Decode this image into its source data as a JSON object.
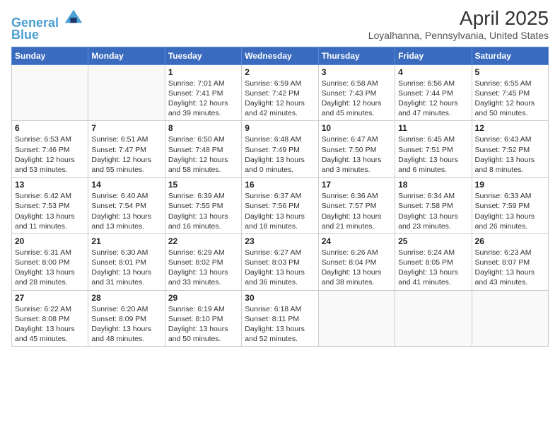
{
  "header": {
    "logo_line1": "General",
    "logo_line2": "Blue",
    "month_year": "April 2025",
    "location": "Loyalhanna, Pennsylvania, United States"
  },
  "days_of_week": [
    "Sunday",
    "Monday",
    "Tuesday",
    "Wednesday",
    "Thursday",
    "Friday",
    "Saturday"
  ],
  "weeks": [
    [
      {
        "day": "",
        "info": ""
      },
      {
        "day": "",
        "info": ""
      },
      {
        "day": "1",
        "info": "Sunrise: 7:01 AM\nSunset: 7:41 PM\nDaylight: 12 hours and 39 minutes."
      },
      {
        "day": "2",
        "info": "Sunrise: 6:59 AM\nSunset: 7:42 PM\nDaylight: 12 hours and 42 minutes."
      },
      {
        "day": "3",
        "info": "Sunrise: 6:58 AM\nSunset: 7:43 PM\nDaylight: 12 hours and 45 minutes."
      },
      {
        "day": "4",
        "info": "Sunrise: 6:56 AM\nSunset: 7:44 PM\nDaylight: 12 hours and 47 minutes."
      },
      {
        "day": "5",
        "info": "Sunrise: 6:55 AM\nSunset: 7:45 PM\nDaylight: 12 hours and 50 minutes."
      }
    ],
    [
      {
        "day": "6",
        "info": "Sunrise: 6:53 AM\nSunset: 7:46 PM\nDaylight: 12 hours and 53 minutes."
      },
      {
        "day": "7",
        "info": "Sunrise: 6:51 AM\nSunset: 7:47 PM\nDaylight: 12 hours and 55 minutes."
      },
      {
        "day": "8",
        "info": "Sunrise: 6:50 AM\nSunset: 7:48 PM\nDaylight: 12 hours and 58 minutes."
      },
      {
        "day": "9",
        "info": "Sunrise: 6:48 AM\nSunset: 7:49 PM\nDaylight: 13 hours and 0 minutes."
      },
      {
        "day": "10",
        "info": "Sunrise: 6:47 AM\nSunset: 7:50 PM\nDaylight: 13 hours and 3 minutes."
      },
      {
        "day": "11",
        "info": "Sunrise: 6:45 AM\nSunset: 7:51 PM\nDaylight: 13 hours and 6 minutes."
      },
      {
        "day": "12",
        "info": "Sunrise: 6:43 AM\nSunset: 7:52 PM\nDaylight: 13 hours and 8 minutes."
      }
    ],
    [
      {
        "day": "13",
        "info": "Sunrise: 6:42 AM\nSunset: 7:53 PM\nDaylight: 13 hours and 11 minutes."
      },
      {
        "day": "14",
        "info": "Sunrise: 6:40 AM\nSunset: 7:54 PM\nDaylight: 13 hours and 13 minutes."
      },
      {
        "day": "15",
        "info": "Sunrise: 6:39 AM\nSunset: 7:55 PM\nDaylight: 13 hours and 16 minutes."
      },
      {
        "day": "16",
        "info": "Sunrise: 6:37 AM\nSunset: 7:56 PM\nDaylight: 13 hours and 18 minutes."
      },
      {
        "day": "17",
        "info": "Sunrise: 6:36 AM\nSunset: 7:57 PM\nDaylight: 13 hours and 21 minutes."
      },
      {
        "day": "18",
        "info": "Sunrise: 6:34 AM\nSunset: 7:58 PM\nDaylight: 13 hours and 23 minutes."
      },
      {
        "day": "19",
        "info": "Sunrise: 6:33 AM\nSunset: 7:59 PM\nDaylight: 13 hours and 26 minutes."
      }
    ],
    [
      {
        "day": "20",
        "info": "Sunrise: 6:31 AM\nSunset: 8:00 PM\nDaylight: 13 hours and 28 minutes."
      },
      {
        "day": "21",
        "info": "Sunrise: 6:30 AM\nSunset: 8:01 PM\nDaylight: 13 hours and 31 minutes."
      },
      {
        "day": "22",
        "info": "Sunrise: 6:29 AM\nSunset: 8:02 PM\nDaylight: 13 hours and 33 minutes."
      },
      {
        "day": "23",
        "info": "Sunrise: 6:27 AM\nSunset: 8:03 PM\nDaylight: 13 hours and 36 minutes."
      },
      {
        "day": "24",
        "info": "Sunrise: 6:26 AM\nSunset: 8:04 PM\nDaylight: 13 hours and 38 minutes."
      },
      {
        "day": "25",
        "info": "Sunrise: 6:24 AM\nSunset: 8:05 PM\nDaylight: 13 hours and 41 minutes."
      },
      {
        "day": "26",
        "info": "Sunrise: 6:23 AM\nSunset: 8:07 PM\nDaylight: 13 hours and 43 minutes."
      }
    ],
    [
      {
        "day": "27",
        "info": "Sunrise: 6:22 AM\nSunset: 8:08 PM\nDaylight: 13 hours and 45 minutes."
      },
      {
        "day": "28",
        "info": "Sunrise: 6:20 AM\nSunset: 8:09 PM\nDaylight: 13 hours and 48 minutes."
      },
      {
        "day": "29",
        "info": "Sunrise: 6:19 AM\nSunset: 8:10 PM\nDaylight: 13 hours and 50 minutes."
      },
      {
        "day": "30",
        "info": "Sunrise: 6:18 AM\nSunset: 8:11 PM\nDaylight: 13 hours and 52 minutes."
      },
      {
        "day": "",
        "info": ""
      },
      {
        "day": "",
        "info": ""
      },
      {
        "day": "",
        "info": ""
      }
    ]
  ]
}
